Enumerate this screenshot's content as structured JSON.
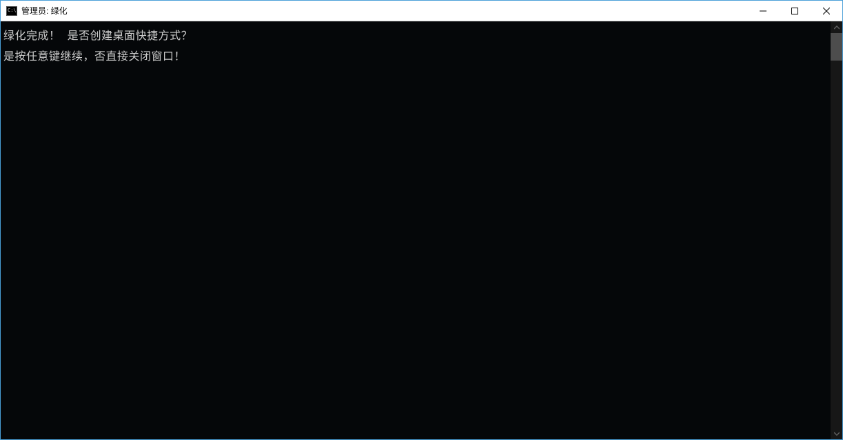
{
  "window": {
    "title": "管理员: 绿化"
  },
  "console": {
    "lines": [
      "绿化完成！ 是否创建桌面快捷方式？",
      "是按任意键继续，否直接关闭窗口！"
    ]
  }
}
